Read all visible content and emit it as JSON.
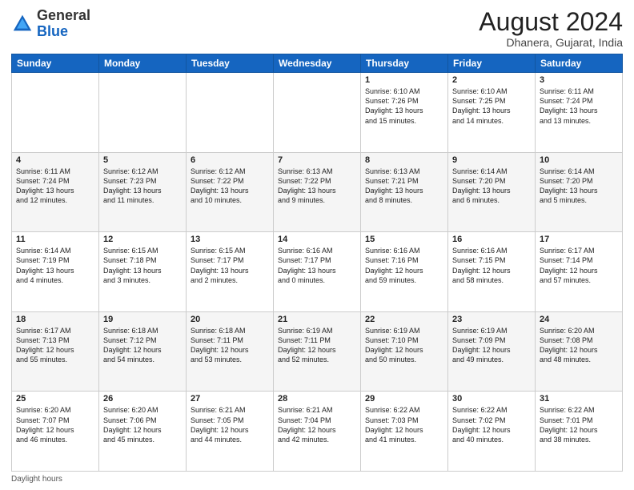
{
  "header": {
    "logo_general": "General",
    "logo_blue": "Blue",
    "month_year": "August 2024",
    "location": "Dhanera, Gujarat, India"
  },
  "footer": {
    "daylight_label": "Daylight hours"
  },
  "days_of_week": [
    "Sunday",
    "Monday",
    "Tuesday",
    "Wednesday",
    "Thursday",
    "Friday",
    "Saturday"
  ],
  "weeks": [
    [
      {
        "day": "",
        "info": ""
      },
      {
        "day": "",
        "info": ""
      },
      {
        "day": "",
        "info": ""
      },
      {
        "day": "",
        "info": ""
      },
      {
        "day": "1",
        "info": "Sunrise: 6:10 AM\nSunset: 7:26 PM\nDaylight: 13 hours\nand 15 minutes."
      },
      {
        "day": "2",
        "info": "Sunrise: 6:10 AM\nSunset: 7:25 PM\nDaylight: 13 hours\nand 14 minutes."
      },
      {
        "day": "3",
        "info": "Sunrise: 6:11 AM\nSunset: 7:24 PM\nDaylight: 13 hours\nand 13 minutes."
      }
    ],
    [
      {
        "day": "4",
        "info": "Sunrise: 6:11 AM\nSunset: 7:24 PM\nDaylight: 13 hours\nand 12 minutes."
      },
      {
        "day": "5",
        "info": "Sunrise: 6:12 AM\nSunset: 7:23 PM\nDaylight: 13 hours\nand 11 minutes."
      },
      {
        "day": "6",
        "info": "Sunrise: 6:12 AM\nSunset: 7:22 PM\nDaylight: 13 hours\nand 10 minutes."
      },
      {
        "day": "7",
        "info": "Sunrise: 6:13 AM\nSunset: 7:22 PM\nDaylight: 13 hours\nand 9 minutes."
      },
      {
        "day": "8",
        "info": "Sunrise: 6:13 AM\nSunset: 7:21 PM\nDaylight: 13 hours\nand 8 minutes."
      },
      {
        "day": "9",
        "info": "Sunrise: 6:14 AM\nSunset: 7:20 PM\nDaylight: 13 hours\nand 6 minutes."
      },
      {
        "day": "10",
        "info": "Sunrise: 6:14 AM\nSunset: 7:20 PM\nDaylight: 13 hours\nand 5 minutes."
      }
    ],
    [
      {
        "day": "11",
        "info": "Sunrise: 6:14 AM\nSunset: 7:19 PM\nDaylight: 13 hours\nand 4 minutes."
      },
      {
        "day": "12",
        "info": "Sunrise: 6:15 AM\nSunset: 7:18 PM\nDaylight: 13 hours\nand 3 minutes."
      },
      {
        "day": "13",
        "info": "Sunrise: 6:15 AM\nSunset: 7:17 PM\nDaylight: 13 hours\nand 2 minutes."
      },
      {
        "day": "14",
        "info": "Sunrise: 6:16 AM\nSunset: 7:17 PM\nDaylight: 13 hours\nand 0 minutes."
      },
      {
        "day": "15",
        "info": "Sunrise: 6:16 AM\nSunset: 7:16 PM\nDaylight: 12 hours\nand 59 minutes."
      },
      {
        "day": "16",
        "info": "Sunrise: 6:16 AM\nSunset: 7:15 PM\nDaylight: 12 hours\nand 58 minutes."
      },
      {
        "day": "17",
        "info": "Sunrise: 6:17 AM\nSunset: 7:14 PM\nDaylight: 12 hours\nand 57 minutes."
      }
    ],
    [
      {
        "day": "18",
        "info": "Sunrise: 6:17 AM\nSunset: 7:13 PM\nDaylight: 12 hours\nand 55 minutes."
      },
      {
        "day": "19",
        "info": "Sunrise: 6:18 AM\nSunset: 7:12 PM\nDaylight: 12 hours\nand 54 minutes."
      },
      {
        "day": "20",
        "info": "Sunrise: 6:18 AM\nSunset: 7:11 PM\nDaylight: 12 hours\nand 53 minutes."
      },
      {
        "day": "21",
        "info": "Sunrise: 6:19 AM\nSunset: 7:11 PM\nDaylight: 12 hours\nand 52 minutes."
      },
      {
        "day": "22",
        "info": "Sunrise: 6:19 AM\nSunset: 7:10 PM\nDaylight: 12 hours\nand 50 minutes."
      },
      {
        "day": "23",
        "info": "Sunrise: 6:19 AM\nSunset: 7:09 PM\nDaylight: 12 hours\nand 49 minutes."
      },
      {
        "day": "24",
        "info": "Sunrise: 6:20 AM\nSunset: 7:08 PM\nDaylight: 12 hours\nand 48 minutes."
      }
    ],
    [
      {
        "day": "25",
        "info": "Sunrise: 6:20 AM\nSunset: 7:07 PM\nDaylight: 12 hours\nand 46 minutes."
      },
      {
        "day": "26",
        "info": "Sunrise: 6:20 AM\nSunset: 7:06 PM\nDaylight: 12 hours\nand 45 minutes."
      },
      {
        "day": "27",
        "info": "Sunrise: 6:21 AM\nSunset: 7:05 PM\nDaylight: 12 hours\nand 44 minutes."
      },
      {
        "day": "28",
        "info": "Sunrise: 6:21 AM\nSunset: 7:04 PM\nDaylight: 12 hours\nand 42 minutes."
      },
      {
        "day": "29",
        "info": "Sunrise: 6:22 AM\nSunset: 7:03 PM\nDaylight: 12 hours\nand 41 minutes."
      },
      {
        "day": "30",
        "info": "Sunrise: 6:22 AM\nSunset: 7:02 PM\nDaylight: 12 hours\nand 40 minutes."
      },
      {
        "day": "31",
        "info": "Sunrise: 6:22 AM\nSunset: 7:01 PM\nDaylight: 12 hours\nand 38 minutes."
      }
    ]
  ]
}
